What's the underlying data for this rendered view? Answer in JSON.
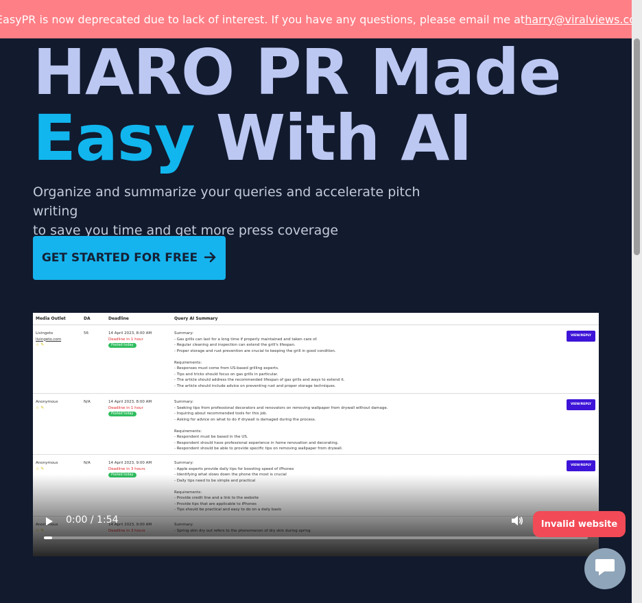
{
  "banner": {
    "message": "EasyPR is now deprecated due to lack of interest.  If you have any questions, please email me at ",
    "email": "harry@viralviews.co"
  },
  "hero": {
    "line1": "HARO PR Made",
    "accent": "Easy",
    "line2_rest": "With AI",
    "subtitle_line1": "Organize and summarize your queries and accelerate pitch writing",
    "subtitle_line2": "to save you time and get more press coverage"
  },
  "cta": {
    "label": "GET STARTED FOR FREE"
  },
  "video": {
    "table": {
      "headers": [
        "Media Outlet",
        "DA",
        "Deadline",
        "Query AI Summary"
      ],
      "rows": [
        {
          "outlet": "Livingeto",
          "link": "livingeto.com",
          "da": "56",
          "date": "14 April 2023, 8:00 AM",
          "deadline": "Deadline in 1 hour",
          "posted": "Posted today",
          "summary": [
            "Summary:",
            "- Gas grills can last for a long time if properly maintained and taken care of.",
            "- Regular cleaning and inspection can extend the grill's lifespan.",
            "- Proper storage and rust prevention are crucial to keeping the grill in good condition.",
            "",
            "Requirements:",
            "- Responses must come from US-based grilling experts.",
            "- Tips and tricks should focus on gas grills in particular.",
            "- The article should address the recommended lifespan of gas grills and ways to extend it.",
            "- The article should include advice on preventing rust and proper storage techniques."
          ],
          "reply": "VIEW/REPLY"
        },
        {
          "outlet": "Anonymous",
          "link": "",
          "da": "N/A",
          "date": "14 April 2023, 8:00 AM",
          "deadline": "Deadline in 1 hour",
          "posted": "Posted today",
          "summary": [
            "Summary:",
            "- Seeking tips from professional decorators and renovators on removing wallpaper from drywall without damage.",
            "- Inquiring about recommended tools for this job.",
            "- Asking for advice on what to do if drywall is damaged during the process.",
            "",
            "Requirements:",
            "- Respondent must be based in the US.",
            "- Respondent should have professional experience in home renovation and decorating.",
            "- Respondent should be able to provide specific tips on removing wallpaper from drywall."
          ],
          "reply": "VIEW/REPLY"
        },
        {
          "outlet": "Anonymous",
          "link": "",
          "da": "N/A",
          "date": "14 April 2023, 9:00 AM",
          "deadline": "Deadline in 3 hours",
          "posted": "Posted today",
          "summary": [
            "Summary:",
            "- Apple experts provide daily tips for boosting speed of iPhones",
            "- Identifying what slows down the phone the most is crucial",
            "- Daily tips need to be simple and practical",
            "",
            "Requirements:",
            "- Provide credit line and a link to the website",
            "- Provide tips that are applicable to iPhones",
            "- Tips should be practical and easy to do on a daily basis"
          ],
          "reply": "VIEW/REPLY"
        },
        {
          "outlet": "Anonymous",
          "link": "",
          "da": "",
          "date": "14 April 2023, 9:00 AM",
          "deadline": "Deadline in 3 hours",
          "posted": "",
          "summary": [
            "Summary:",
            "- Spring skin dry out refers to the phenomenon of dry skin during spring"
          ],
          "reply": ""
        }
      ]
    },
    "time": "0:00 / 1:54",
    "progress_fraction": 0.015
  },
  "badge": {
    "label": "Invalid website"
  },
  "colors": {
    "background": "#121a2e",
    "banner": "#ff7f86",
    "accent": "#11b6ee",
    "title": "#bcc8f2",
    "badge": "#f24a56"
  },
  "icons": {
    "cta": "arrow-right-icon",
    "play": "play-icon",
    "volume": "volume-icon",
    "chat": "chat-bubble-icon"
  }
}
